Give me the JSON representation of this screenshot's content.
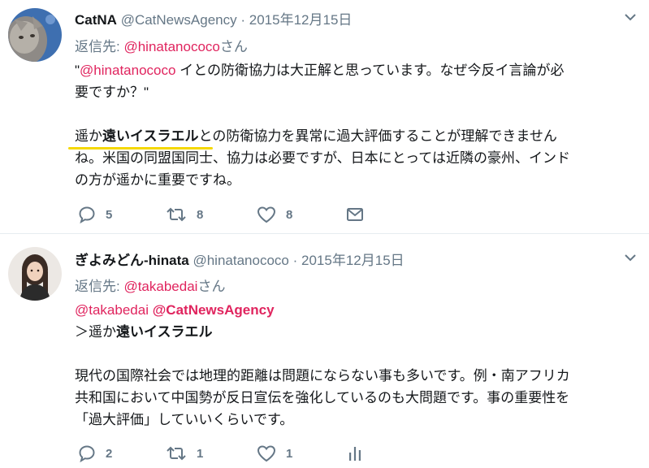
{
  "tweets": [
    {
      "name": "CatNA",
      "handle": "@CatNewsAgency",
      "separator": "·",
      "date": "2015年12月15日",
      "reply_prefix": "返信先: ",
      "reply_handle": "@hinatanococo",
      "reply_suffix": "さん",
      "body": {
        "l1_pre": "\"",
        "l1_mention": "@hinatanococo",
        "l1_post": " イとの防衛協力は大正解と思っています。なぜ今反イ言論が必",
        "l2": "要ですか？\"",
        "l4_pre": "遥か",
        "l4_bold": "遠いイスラエル",
        "l4_post": "との防衛協力を異常に過大評価することが理解できません",
        "l5": "ね。米国の同盟国同士、協力は必要ですが、日本にとっては近隣の豪州、インド",
        "l6": "の方が遥かに重要ですね。"
      },
      "counts": {
        "reply": "5",
        "retweet": "8",
        "like": "8"
      },
      "icons": [
        "reply-icon",
        "retweet-icon",
        "like-icon",
        "message-icon"
      ]
    },
    {
      "name": "ぎよみどん-hinata",
      "handle": "@hinatanococo",
      "separator": "·",
      "date": "2015年12月15日",
      "reply_prefix": "返信先: ",
      "reply_handle": "@takabedai",
      "reply_suffix": "さん",
      "body": {
        "l1_m1": "@takabedai",
        "l1_m2": "@CatNewsAgency",
        "l2_pre": "＞遥か",
        "l2_bold": "遠いイスラエル",
        "l4": "現代の国際社会では地理的距離は問題にならない事も多いです。例・南アフリカ",
        "l5": "共和国において中国勢が反日宣伝を強化しているのも大問題です。事の重要性を",
        "l6": "「過大評価」していいくらいです。"
      },
      "counts": {
        "reply": "2",
        "retweet": "1",
        "like": "1"
      },
      "icons": [
        "reply-icon",
        "retweet-icon",
        "like-icon",
        "analytics-icon"
      ]
    }
  ],
  "colors": {
    "mention": "#e0245e",
    "muted": "#657786",
    "text": "#14171a",
    "highlight": "#f5d800"
  }
}
